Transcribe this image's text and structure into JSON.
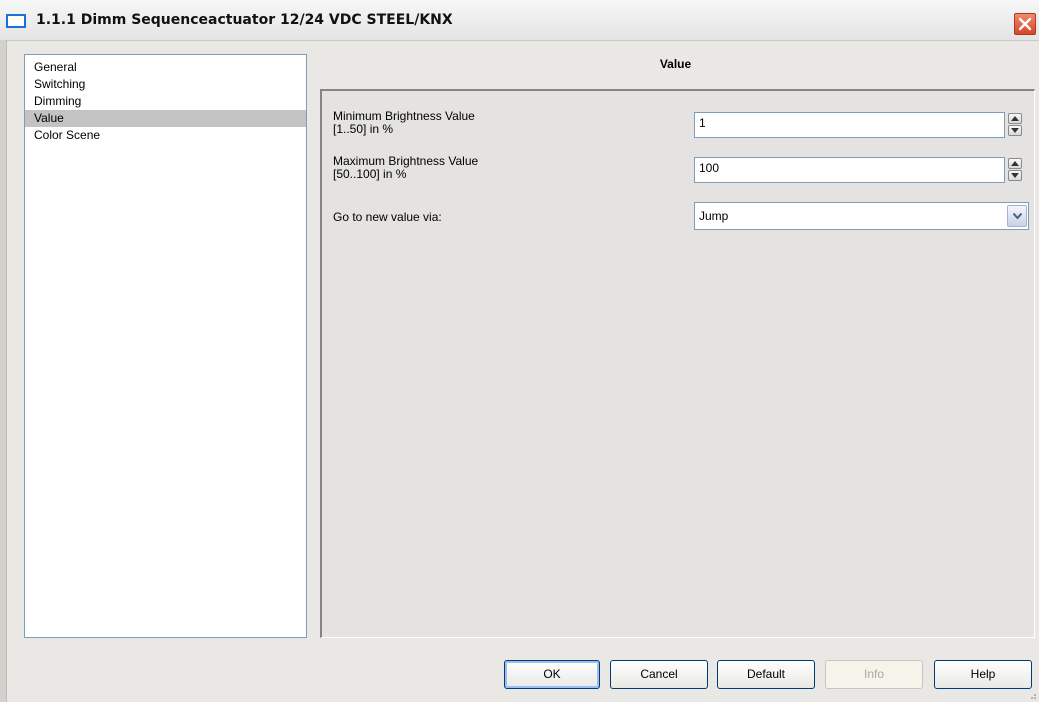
{
  "window": {
    "title": "1.1.1 Dimm Sequenceactuator 12/24 VDC STEEL/KNX",
    "icons": {
      "app": "window-icon",
      "close": "close-icon"
    }
  },
  "nav": {
    "items": [
      {
        "label": "General",
        "selected": false
      },
      {
        "label": "Switching",
        "selected": false
      },
      {
        "label": "Dimming",
        "selected": false
      },
      {
        "label": "Value",
        "selected": true
      },
      {
        "label": "Color Scene",
        "selected": false
      }
    ]
  },
  "panel": {
    "title": "Value",
    "params": {
      "min_brightness": {
        "label_line1": "Minimum Brightness Value",
        "label_line2": "[1..50] in %",
        "value": "1"
      },
      "max_brightness": {
        "label_line1": "Maximum Brightness Value",
        "label_line2": "[50..100] in %",
        "value": "100"
      },
      "transition": {
        "label": "Go to new value via:",
        "value": "Jump"
      }
    }
  },
  "buttons": {
    "ok": "OK",
    "cancel": "Cancel",
    "default": "Default",
    "info": "Info",
    "help": "Help"
  },
  "colors": {
    "accent": "#1a6fd8",
    "selection": "#c3c3c3",
    "close": "#d6452a"
  }
}
